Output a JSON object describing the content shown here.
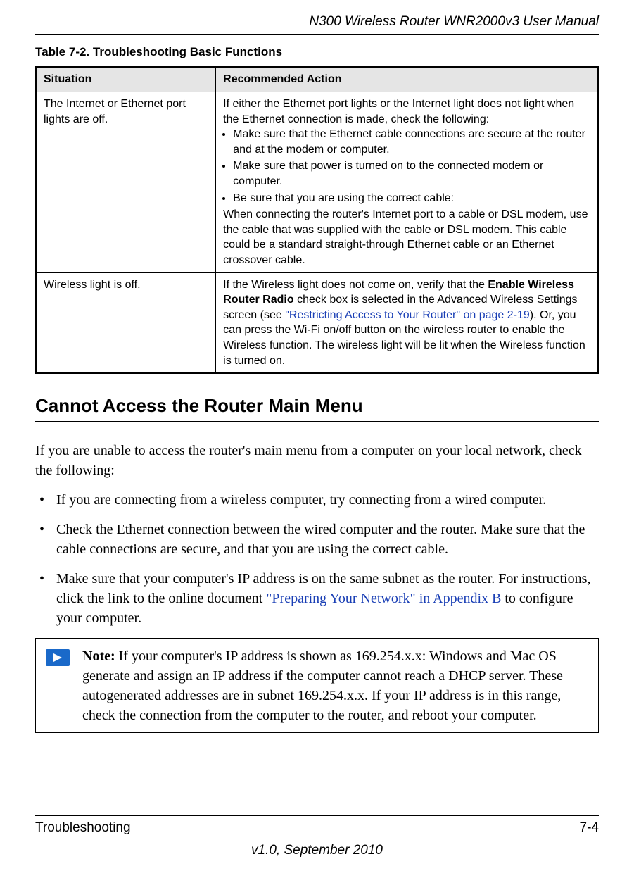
{
  "header": {
    "manual_title": "N300 Wireless Router WNR2000v3 User Manual"
  },
  "table": {
    "caption": "Table 7-2.  Troubleshooting Basic Functions",
    "headers": {
      "situation": "Situation",
      "action": "Recommended Action"
    },
    "rows": [
      {
        "situation": "The Internet or Ethernet port lights are off.",
        "action_intro": "If either the Ethernet port lights or the Internet light does not light when the Ethernet connection is made, check the following:",
        "bullets": [
          "Make sure that the Ethernet cable connections are secure at the router and at the modem or computer.",
          "Make sure that power is turned on to the connected modem or computer.",
          "Be sure that you are using the correct cable:"
        ],
        "action_outro": "When connecting the router's Internet port to a cable or DSL modem, use the cable that was supplied with the cable or DSL modem. This cable could be a standard straight-through Ethernet cable or an Ethernet crossover cable."
      },
      {
        "situation": "Wireless light is off.",
        "action_pre": "If the Wireless light does not come on, verify that the ",
        "action_bold": "Enable Wireless Router Radio",
        "action_mid": " check box is selected in the Advanced Wireless Settings screen (see ",
        "action_link": "\"Restricting Access to Your Router\" on page 2-19",
        "action_post": "). Or, you can press the Wi-Fi on/off button on the wireless router to enable the Wireless function. The wireless light will be lit when the Wireless function is turned on."
      }
    ]
  },
  "section": {
    "heading": "Cannot Access the Router Main Menu",
    "intro": "If you are unable to access the router's main menu from a computer on your local network, check the following:",
    "items": [
      {
        "text": "If you are connecting from a wireless computer, try connecting from a wired computer."
      },
      {
        "text": "Check the Ethernet connection between the wired computer and the router. Make sure that the cable connections are secure, and that you are using the correct cable."
      },
      {
        "pre": "Make sure that your computer's IP address is on the same subnet as the router. For instructions, click the link to the online document ",
        "link": "\"Preparing Your Network\" in Appendix B",
        "post": " to configure your computer."
      }
    ]
  },
  "note": {
    "label": "Note:",
    "text": " If your computer's IP address is shown as 169.254.x.x: Windows and Mac OS generate and assign an IP address if the computer cannot reach a DHCP server. These autogenerated addresses are in subnet 169.254.x.x. If your IP address is in this range, check the connection from the computer to the router, and reboot your computer."
  },
  "footer": {
    "section": "Troubleshooting",
    "page": "7-4",
    "version": "v1.0, September 2010"
  }
}
